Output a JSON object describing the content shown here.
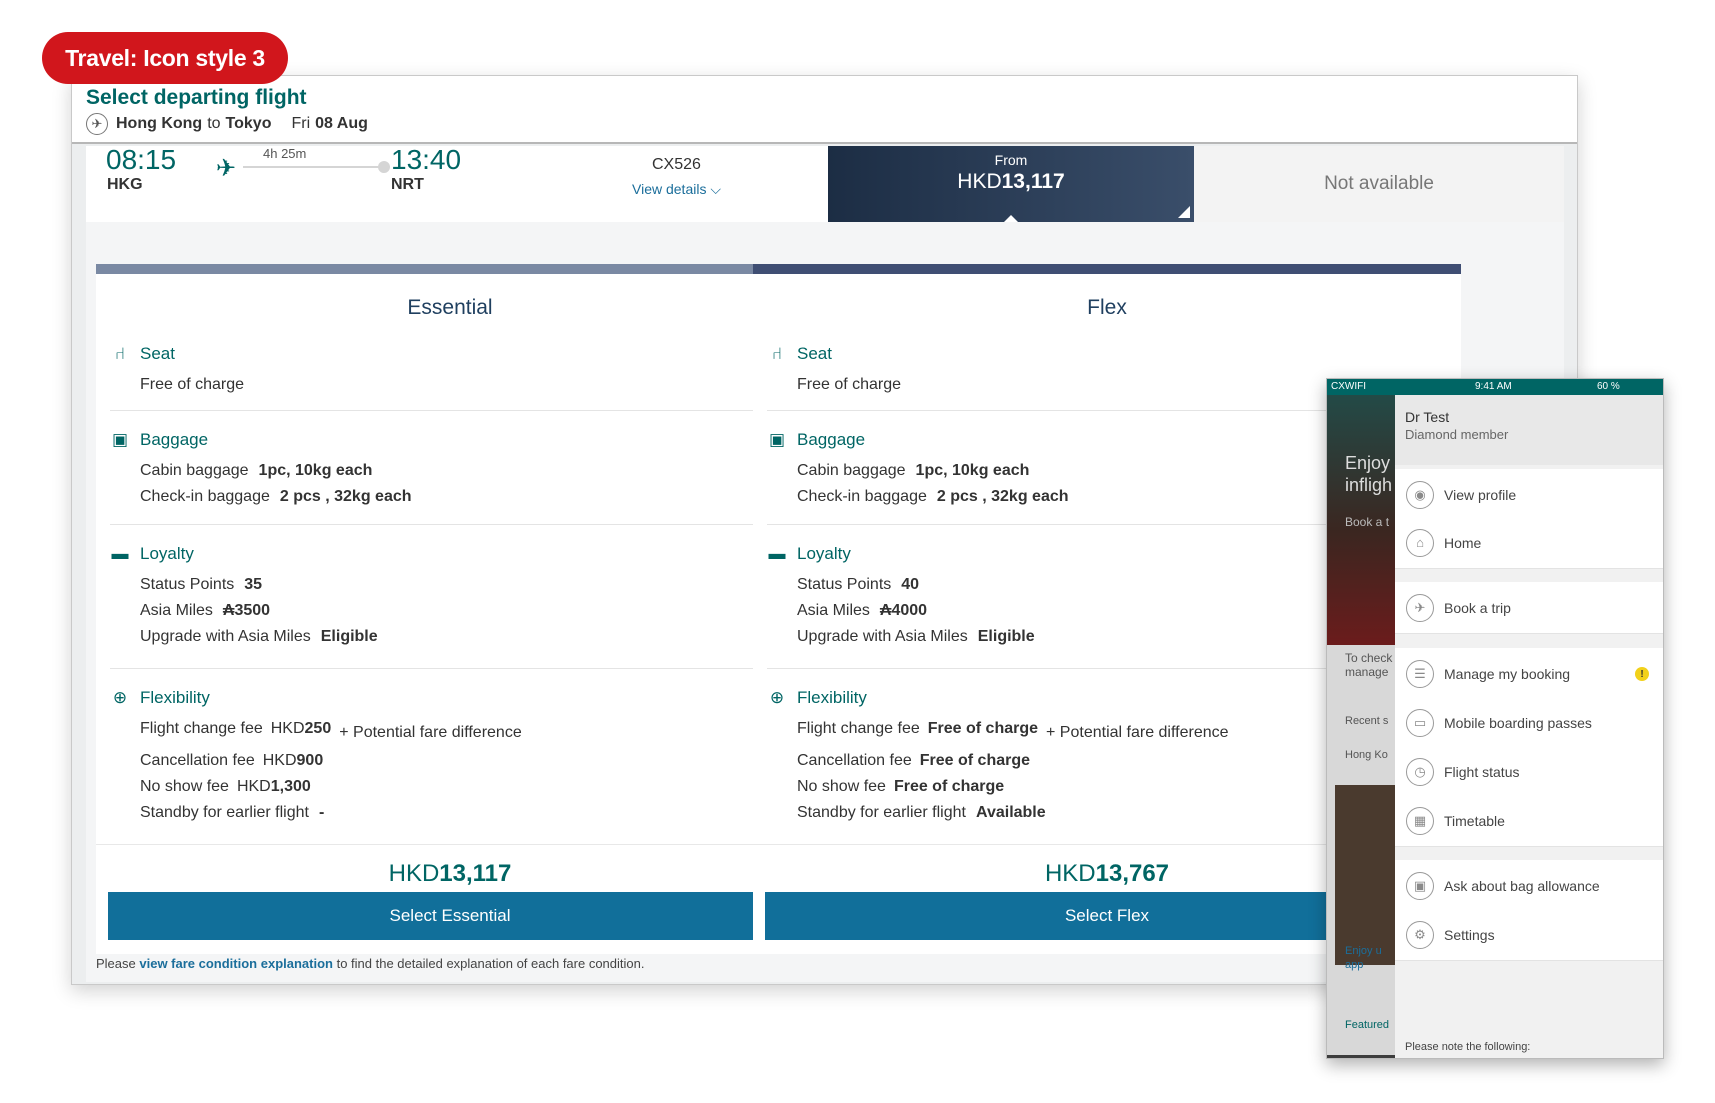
{
  "tag": "Travel: Icon style 3",
  "header": {
    "title": "Select departing flight",
    "origin": "Hong Kong",
    "to_word": "to",
    "destination": "Tokyo",
    "day": "Fri",
    "date": "08 Aug"
  },
  "flight": {
    "dep_time": "08:15",
    "dep_code": "HKG",
    "duration": "4h 25m",
    "arr_time": "13:40",
    "arr_code": "NRT",
    "flight_no": "CX526",
    "view_details": "View details ⌵",
    "from_label": "From",
    "from_currency": "HKD",
    "from_amount": "13,117",
    "not_available": "Not available"
  },
  "fares": [
    {
      "name": "Essential",
      "band_color": "#7a89a3",
      "seat_label": "Seat",
      "seat_value": "Free of charge",
      "baggage_label": "Baggage",
      "cabin_label": "Cabin baggage",
      "cabin_value": "1pc, 10kg each",
      "checkin_label": "Check-in baggage",
      "checkin_value": "2 pcs , 32kg each",
      "loyalty_label": "Loyalty",
      "status_label": "Status Points",
      "status_value": "35",
      "miles_label": "Asia Miles",
      "miles_value": "₳3500",
      "upgrade_label": "Upgrade with Asia Miles",
      "upgrade_value": "Eligible",
      "flex_label": "Flexibility",
      "change_label": "Flight change fee",
      "change_currency": "HKD",
      "change_value": "250",
      "change_extra": "+ Potential fare difference",
      "cancel_label": "Cancellation fee",
      "cancel_currency": "HKD",
      "cancel_value": "900",
      "noshow_label": "No show fee",
      "noshow_currency": "HKD",
      "noshow_value": "1,300",
      "standby_label": "Standby for earlier flight",
      "standby_value": "-",
      "price_currency": "HKD",
      "price_amount": "13,117",
      "button": "Select Essential"
    },
    {
      "name": "Flex",
      "band_color": "#3f4e73",
      "seat_label": "Seat",
      "seat_value": "Free of charge",
      "baggage_label": "Baggage",
      "cabin_label": "Cabin baggage",
      "cabin_value": "1pc, 10kg each",
      "checkin_label": "Check-in baggage",
      "checkin_value": "2 pcs , 32kg each",
      "loyalty_label": "Loyalty",
      "status_label": "Status Points",
      "status_value": "40",
      "miles_label": "Asia Miles",
      "miles_value": "₳4000",
      "upgrade_label": "Upgrade with Asia Miles",
      "upgrade_value": "Eligible",
      "flex_label": "Flexibility",
      "change_label": "Flight change fee",
      "change_currency": "",
      "change_value": "Free of charge",
      "change_extra": "+ Potential fare difference",
      "cancel_label": "Cancellation fee",
      "cancel_currency": "",
      "cancel_value": "Free of charge",
      "noshow_label": "No show fee",
      "noshow_currency": "",
      "noshow_value": "Free of charge",
      "standby_label": "Standby for earlier flight",
      "standby_value": "Available",
      "price_currency": "HKD",
      "price_amount": "13,767",
      "button": "Select Flex"
    }
  ],
  "footnote": {
    "pre": "Please",
    "link": "view fare condition explanation",
    "post": "to find the detailed explanation of each fare condition."
  },
  "mobile": {
    "carrier": "CXWIFI",
    "time": "9:41 AM",
    "battery": "60 %",
    "user_name": "Dr Test",
    "user_tier": "Diamond member",
    "bg_texts": [
      "Enjoy",
      "infligh",
      "Book a t",
      "To check",
      "manage",
      "Recent s",
      "Hong Ko",
      "Enjoy u",
      "app",
      "Featured"
    ],
    "menu": [
      {
        "label": "View profile",
        "icon": "profile-icon"
      },
      {
        "label": "Home",
        "icon": "home-icon"
      },
      {
        "label": "Book a trip",
        "icon": "plane-icon"
      },
      {
        "label": "Manage my booking",
        "icon": "booking-icon",
        "alert": "!"
      },
      {
        "label": "Mobile boarding passes",
        "icon": "boarding-pass-icon"
      },
      {
        "label": "Flight status",
        "icon": "clock-icon"
      },
      {
        "label": "Timetable",
        "icon": "timetable-icon"
      },
      {
        "label": "Ask about bag allowance",
        "icon": "bag-icon"
      },
      {
        "label": "Settings",
        "icon": "gear-icon"
      }
    ],
    "note": "Please note the following:"
  }
}
